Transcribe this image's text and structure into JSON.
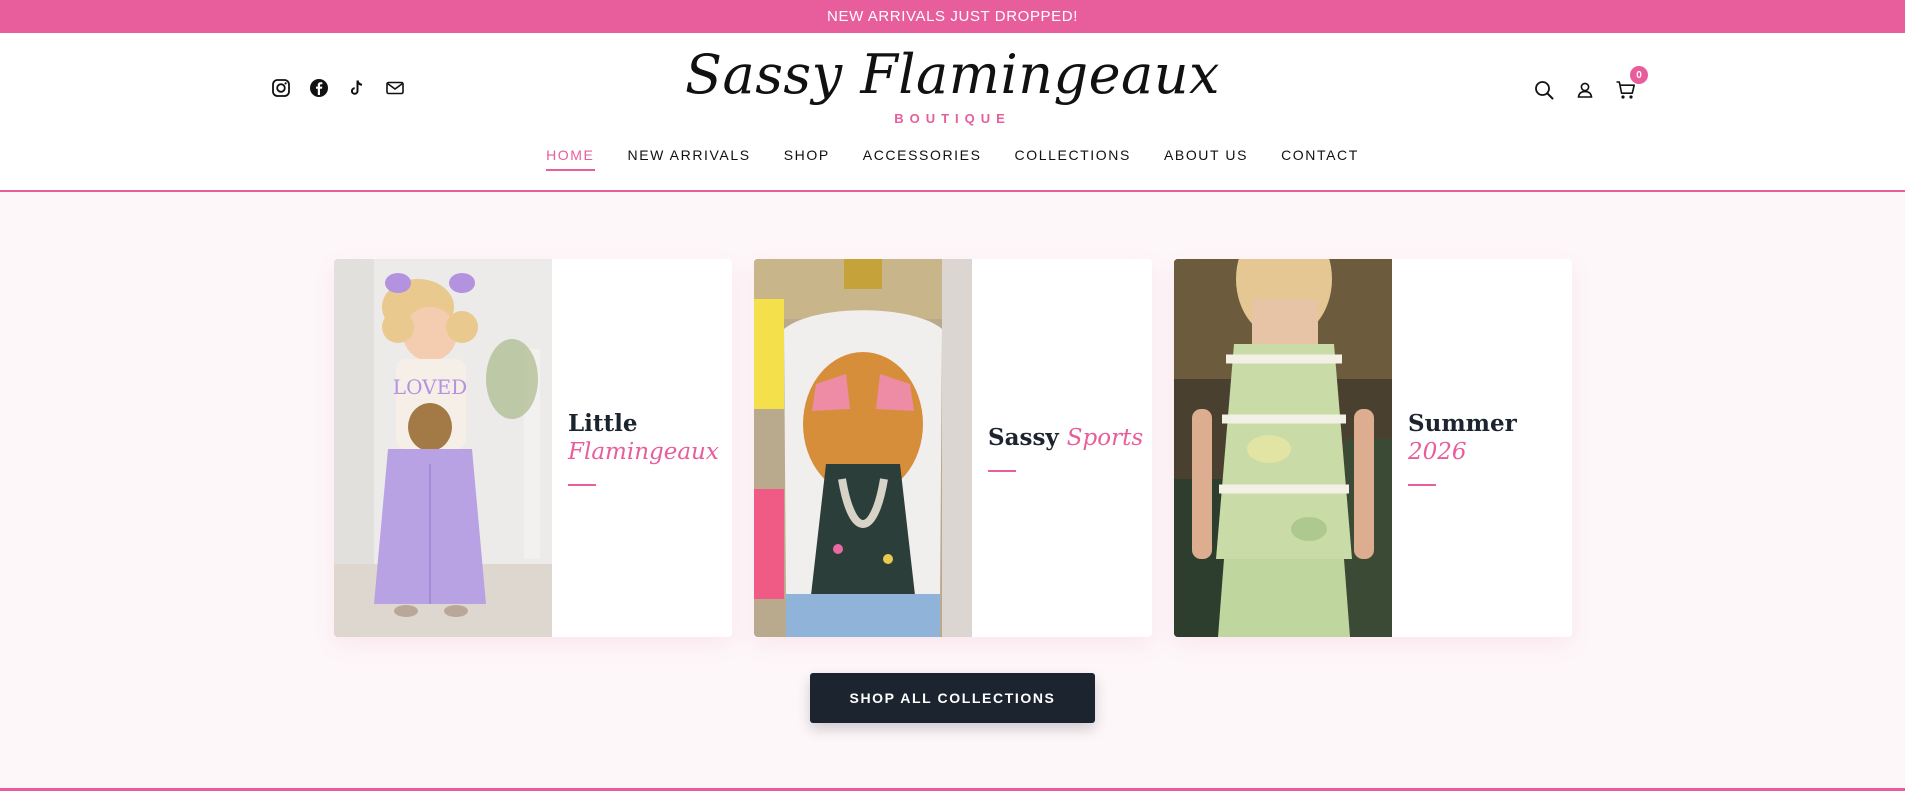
{
  "announcement": "NEW ARRIVALS JUST DROPPED!",
  "brand": {
    "name": "Sassy Flamingeaux",
    "tagline": "BOUTIQUE",
    "accent": "#e85d9b"
  },
  "socials": [
    "instagram-icon",
    "facebook-icon",
    "tiktok-icon",
    "mail-icon"
  ],
  "nav": {
    "items": [
      {
        "label": "HOME",
        "active": true
      },
      {
        "label": "NEW ARRIVALS"
      },
      {
        "label": "SHOP"
      },
      {
        "label": "ACCESSORIES"
      },
      {
        "label": "COLLECTIONS"
      },
      {
        "label": "ABOUT US"
      },
      {
        "label": "CONTACT"
      }
    ]
  },
  "tools": {
    "icons": [
      "search-icon",
      "account-icon",
      "cart-icon"
    ],
    "cart_count": "0"
  },
  "collections": [
    {
      "title": "Little",
      "accent": "Flamingeaux",
      "image": "toddler-outfit-photo"
    },
    {
      "title": "Sassy",
      "accent": "Sports",
      "image": "tiger-tee-photo"
    },
    {
      "title": "Summer",
      "accent": "2026",
      "image": "summer-set-photo"
    }
  ],
  "cta": "SHOP ALL COLLECTIONS"
}
